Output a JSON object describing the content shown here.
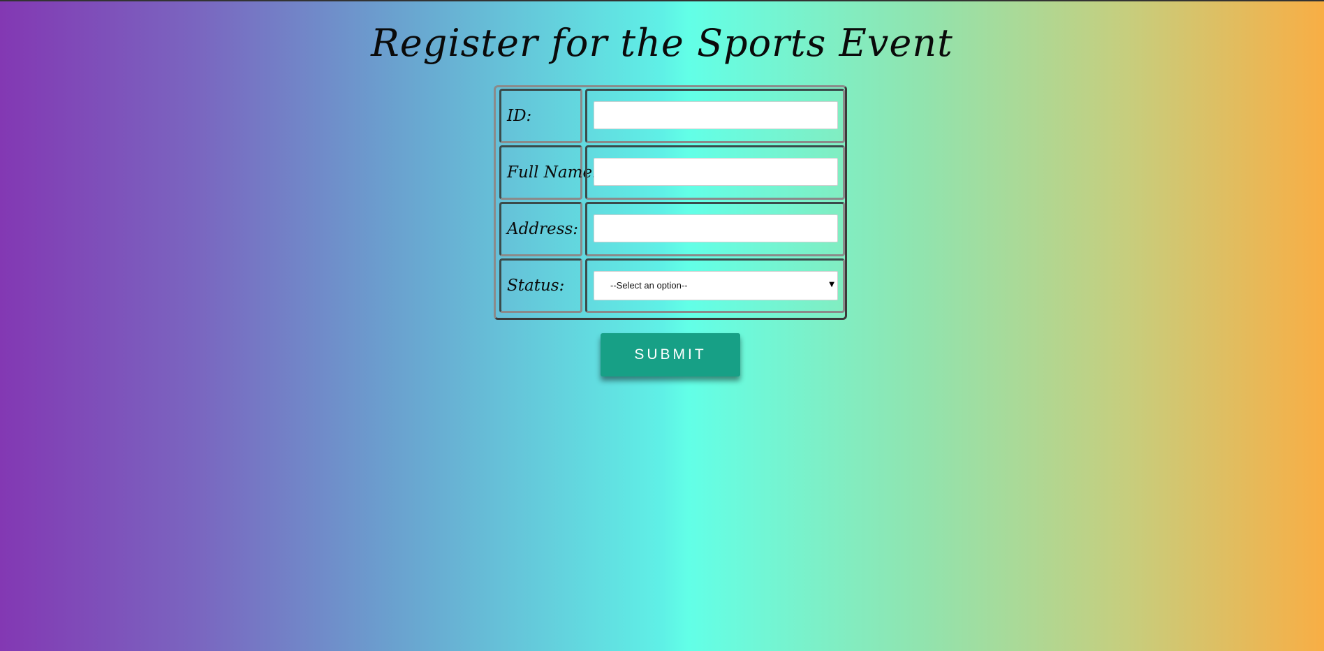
{
  "page": {
    "title": "Register for the Sports Event"
  },
  "form": {
    "fields": [
      {
        "label": "ID:",
        "type": "text",
        "value": ""
      },
      {
        "label": "Full Name:",
        "type": "text",
        "value": ""
      },
      {
        "label": "Address:",
        "type": "text",
        "value": ""
      },
      {
        "label": "Status:",
        "type": "select",
        "selected": "--Select an option--"
      }
    ],
    "submit_label": "SUBMIT"
  },
  "colors": {
    "gradient_left": "#8338b3",
    "gradient_center": "#62ffe7",
    "gradient_right": "#f8ae45",
    "submit_button": "#17a086"
  },
  "icons": {
    "select_arrow": "triangle-down-icon"
  }
}
